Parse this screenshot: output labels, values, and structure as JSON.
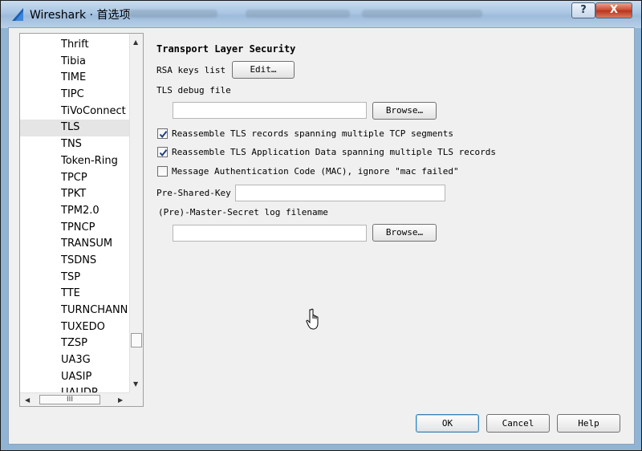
{
  "window": {
    "title": "Wireshark · 首选项",
    "help_button": "?",
    "close_button": "X"
  },
  "sidebar": {
    "items": [
      {
        "label": "Thrift"
      },
      {
        "label": "Tibia"
      },
      {
        "label": "TIME"
      },
      {
        "label": "TIPC"
      },
      {
        "label": "TiVoConnect"
      },
      {
        "label": "TLS",
        "selected": true
      },
      {
        "label": "TNS"
      },
      {
        "label": "Token-Ring"
      },
      {
        "label": "TPCP"
      },
      {
        "label": "TPKT"
      },
      {
        "label": "TPM2.0"
      },
      {
        "label": "TPNCP"
      },
      {
        "label": "TRANSUM"
      },
      {
        "label": "TSDNS"
      },
      {
        "label": "TSP"
      },
      {
        "label": "TTE"
      },
      {
        "label": "TURNCHANN"
      },
      {
        "label": "TUXEDO"
      },
      {
        "label": "TZSP"
      },
      {
        "label": "UA3G"
      },
      {
        "label": "UASIP"
      },
      {
        "label": "UAUDP"
      }
    ],
    "hscroll_thumb": "III"
  },
  "tls": {
    "heading": "Transport Layer Security",
    "rsa_keys_label": "RSA keys list",
    "edit_button": "Edit…",
    "debug_file_label": "TLS debug file",
    "debug_file_value": "",
    "browse_button": "Browse…",
    "options": [
      {
        "label": "Reassemble TLS records spanning multiple TCP segments",
        "checked": true
      },
      {
        "label": "Reassemble TLS Application Data spanning multiple TLS records",
        "checked": true
      },
      {
        "label": "Message Authentication Code (MAC), ignore \"mac failed\"",
        "checked": false
      }
    ],
    "psk_label": "Pre-Shared-Key",
    "psk_value": "",
    "master_secret_label": "(Pre)-Master-Secret log filename",
    "master_secret_value": "",
    "browse_button_2": "Browse…"
  },
  "footer": {
    "ok": "OK",
    "cancel": "Cancel",
    "help": "Help"
  },
  "icons": {
    "app": "wireshark-fin-icon",
    "pointer": "hand-pointer-icon"
  },
  "colors": {
    "titlebar": "#a9c5e2",
    "close": "#c9452a",
    "selection": "#e5e5e5",
    "check": "#1f3f7f"
  }
}
